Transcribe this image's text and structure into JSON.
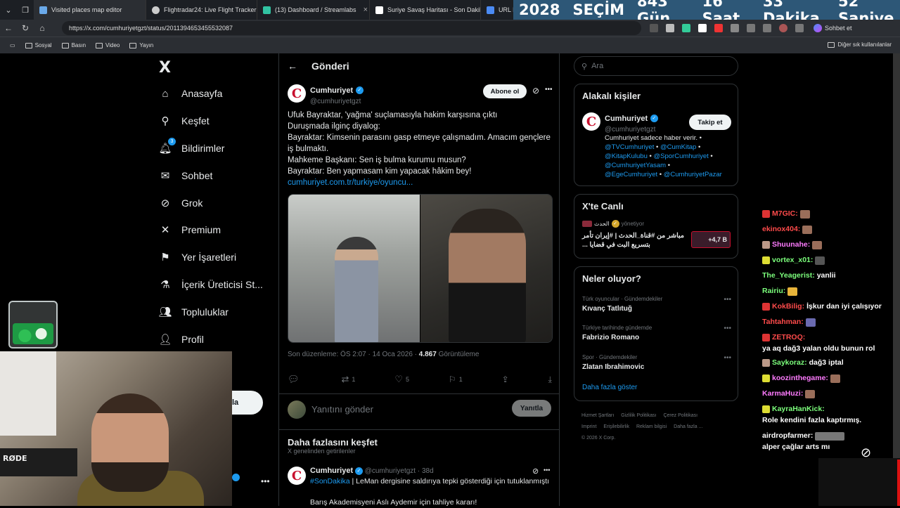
{
  "browser": {
    "tabs": [
      {
        "title": "Visited places map editor",
        "color": "#6aa9e9"
      },
      {
        "title": "Flightradar24: Live Flight Tracker -",
        "color": "#cccccc"
      },
      {
        "title": "(13) Dashboard / Streamlabs",
        "color": "#31c3a2"
      },
      {
        "title": "Suriye Savaş Haritası - Son Dakika",
        "color": "#ffffff"
      },
      {
        "title": "URL N",
        "color": "#4b8bf4"
      }
    ],
    "url": "https://x.com/cumhuriyetgzt/status/2011394653455532087",
    "chat_label": "Sohbet et",
    "bookmarks": [
      "Sosyal",
      "Basın",
      "Video",
      "Yayın"
    ],
    "other_bookmarks": "Diğer sık kullanılanlar"
  },
  "countdown": {
    "year": "2028",
    "label": "SEÇİM",
    "days": "843 Gün",
    "hours": "16 Saat",
    "minutes": "33 Dakika",
    "seconds": "52 Saniye"
  },
  "nav": {
    "logo": "X",
    "items": [
      {
        "label": "Anasayfa",
        "icon": "home-icon"
      },
      {
        "label": "Keşfet",
        "icon": "search-icon"
      },
      {
        "label": "Bildirimler",
        "icon": "bell-icon",
        "badge": "3"
      },
      {
        "label": "Sohbet",
        "icon": "mail-icon"
      },
      {
        "label": "Grok",
        "icon": "grok-icon"
      },
      {
        "label": "Premium",
        "icon": "x-icon"
      },
      {
        "label": "Yer İşaretleri",
        "icon": "bookmark-icon"
      },
      {
        "label": "İçerik Üreticisi St...",
        "icon": "flask-icon"
      },
      {
        "label": "Topluluklar",
        "icon": "people-icon"
      },
      {
        "label": "Profil",
        "icon": "user-icon"
      }
    ],
    "post_button": "la"
  },
  "post": {
    "header": "Gönderi",
    "author": "Cumhuriyet",
    "handle": "@cumhuriyetgzt",
    "subscribe": "Abone ol",
    "lines": [
      "Ufuk Bayraktar, 'yağma' suçlamasıyla hakim karşısına çıktı",
      "Duruşmada ilginç diyalog:",
      "Bayraktar: Kimsenin parasını gasp etmeye çalışmadım. Amacım gençlere iş bulmaktı.",
      "Mahkeme Başkanı: Sen iş bulma kurumu musun?",
      "Bayraktar: Ben yapmasam kim yapacak hâkim bey!"
    ],
    "link": "cumhuriyet.com.tr/turkiye/oyuncu...",
    "meta_edited": "Son düzenleme: ÖS 2:07 · 14 Oca 2026 ·",
    "views": "4.867",
    "views_label": "Görüntüleme",
    "stats": {
      "replies": "",
      "reposts": "1",
      "likes": "5",
      "bookmarks": "1"
    },
    "reply_placeholder": "Yanıtını gönder",
    "reply_button": "Yanıtla"
  },
  "discover": {
    "title": "Daha fazlasını keşfet",
    "subtitle": "X genelinden getirilenler",
    "tweet": {
      "author": "Cumhuriyet",
      "handle": "@cumhuriyetgzt",
      "time": "· 38d",
      "hashtag": "#SonDakika",
      "text": " | LeMan dergisine saldırıya tepki gösterdiği için tutuklanmıştı",
      "text2": "Barış Akademisyeni Aslı Aydemir için tahliye kararı!"
    }
  },
  "right": {
    "search_placeholder": "Ara",
    "related": {
      "title": "Alakalı kişiler",
      "name": "Cumhuriyet",
      "handle": "@cumhuriyetgzt",
      "follow": "Takip et",
      "bio": "Cumhuriyet sadece haber verir. •",
      "mentions": [
        "@TVCumhuriyet",
        "@CumKitap",
        "@KitapKulubu",
        "@SporCumhuriyet",
        "@CumhuriyetYasam",
        "@EgeCumhuriyet",
        "@CumhuriyetPazar"
      ]
    },
    "live": {
      "title": "X'te Canlı",
      "host": "الحدث",
      "host_status": "yönetiyor",
      "text": "مباشر من #قناة_الحدث | #إيران تأمر بتسريع البت في قضايا ...",
      "count": "+4,7 B"
    },
    "trends": {
      "title": "Neler oluyor?",
      "items": [
        {
          "category": "Türk oyuncular · Gündemdekiler",
          "name": "Kıvanç Tatlıtuğ"
        },
        {
          "category": "Türkiye tarihinde gündemde",
          "name": "Fabrizio Romano"
        },
        {
          "category": "Spor · Gündemdekiler",
          "name": "Zlatan Ibrahimovic"
        }
      ],
      "show_more": "Daha fazla göster"
    },
    "footer": [
      "Hizmet Şartları",
      "Gizlilik Politikası",
      "Çerez Politikası",
      "Imprint",
      "Erişilebilirlik",
      "Reklam bilgisi",
      "Daha fazla ...",
      "© 2026 X Corp."
    ]
  },
  "chat": [
    {
      "user": "M7GIC:",
      "msg": "",
      "color": "#ff4b4b"
    },
    {
      "user": "ekinox404:",
      "msg": "",
      "color": "#ff4b4b"
    },
    {
      "user": "Shuunahe:",
      "msg": "",
      "color": "#ff7bff"
    },
    {
      "user": "vortex_x01:",
      "msg": "",
      "color": "#7cff7c"
    },
    {
      "user": "The_Yeagerist:",
      "msg": "yanlii",
      "color": "#7cff7c"
    },
    {
      "user": "Rairiu:",
      "msg": "",
      "color": "#7cff7c"
    },
    {
      "user": "KokBilig:",
      "msg": "İşkur dan iyi çalışıyor",
      "color": "#ff4b4b"
    },
    {
      "user": "Tahtahman:",
      "msg": "",
      "color": "#ff4b4b"
    },
    {
      "user": "ZETROQ:",
      "msg": "ya aq dağ3 yalan oldu bunun rol",
      "color": "#ff4b4b"
    },
    {
      "user": "Saykoraz:",
      "msg": "dağ3 iptal",
      "color": "#7cff7c"
    },
    {
      "user": "koozinthegame:",
      "msg": "",
      "color": "#ff7bff"
    },
    {
      "user": "KarmaHuzi:",
      "msg": "",
      "color": "#ff7bff"
    },
    {
      "user": "KayraHanKick:",
      "msg": "Role kendini fazla kaptırmış.",
      "color": "#7cff7c"
    },
    {
      "user": "airdropfarmer:",
      "msg": "alper çağlar arts mı",
      "color": "#ffffff"
    }
  ],
  "webcam": {
    "mic_brand": "RØDE"
  },
  "colors": {
    "accent": "#1d9bf0",
    "countdown_bg": "#2d5777",
    "brand_red": "#c8102e"
  }
}
